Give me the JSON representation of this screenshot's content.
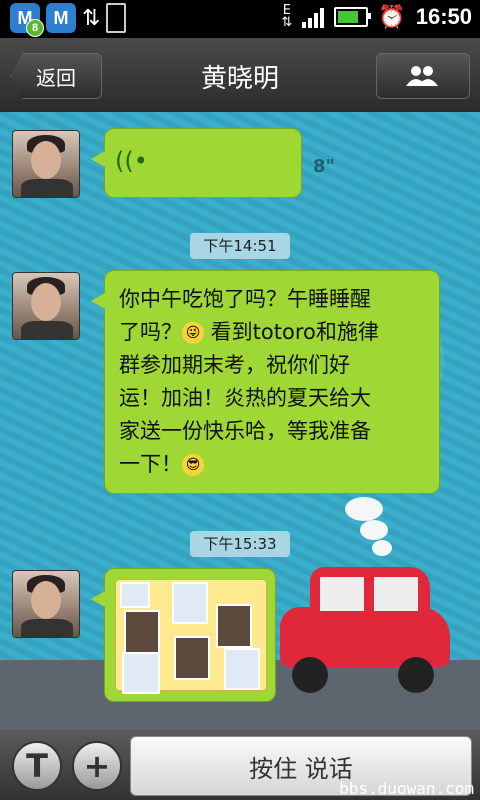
{
  "statusbar": {
    "badge_count": "8",
    "network": "E",
    "time": "16:50"
  },
  "header": {
    "back_label": "返回",
    "title": "黄晓明"
  },
  "messages": [
    {
      "type": "voice",
      "duration": "8\""
    },
    {
      "timestamp": "下午14:51"
    },
    {
      "type": "text",
      "lines": [
        "你中午吃饱了吗？午睡睡醒",
        "了吗？",
        " 看到totoro和施律",
        "群参加期末考，祝你们好",
        "运！加油！炎热的夏天给大",
        "家送一份快乐哈，等我准备",
        "一下！"
      ]
    },
    {
      "timestamp": "下午15:33"
    },
    {
      "type": "sticker"
    }
  ],
  "inputbar": {
    "talk_label": "按住 说话"
  },
  "watermark": "bbs.duowan.com",
  "colors": {
    "bubble": "#9fd834",
    "chat_background": "#3aa9c6"
  }
}
